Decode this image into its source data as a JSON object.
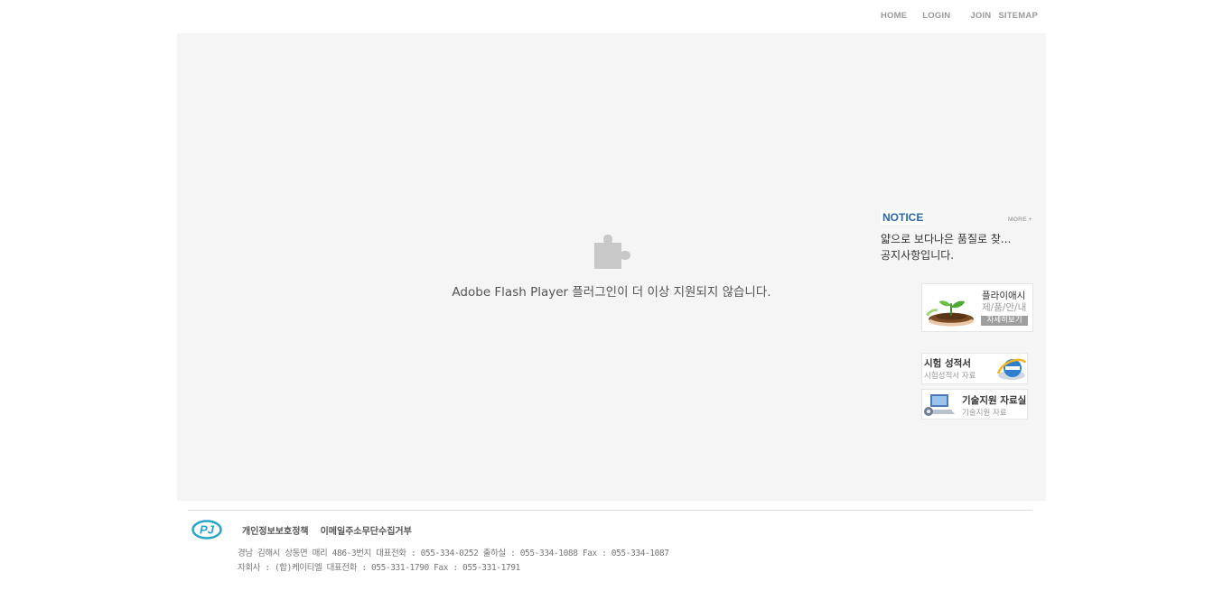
{
  "topnav": {
    "home": "HOME",
    "login": "LOGIN",
    "join": "JOIN",
    "sitemap": "SITEMAP"
  },
  "flash": {
    "message": "Adobe Flash Player 플러그인이 더 이상 지원되지 않습니다.",
    "icon": "puzzle-plugin-icon"
  },
  "notice": {
    "title": "NOTICE",
    "more": "MORE +",
    "items": [
      "얇으로 보다나은 품질로 찾...",
      "공지사항입니다."
    ]
  },
  "banners": {
    "product": {
      "title": "플라이애시",
      "subtitle": "제/품/안/내",
      "button": "자세히보기",
      "icon": "plant-in-hands-icon"
    },
    "test_report": {
      "title": "시험 성적서",
      "subtitle": "시험성적서 자료",
      "icon": "internet-explorer-icon"
    },
    "tech_support": {
      "title": "기술지원 자료실",
      "subtitle": "기술지원 자료",
      "icon": "computer-gear-icon"
    }
  },
  "footer": {
    "logo_text": "PJ",
    "links": [
      "개인정보보호정책",
      "이메일주소무단수집거부"
    ],
    "line1": "경남 김해시 상동면 매리 486-3번지   대표전화 : 055-334-0252   출하실 : 055-334-1088   Fax : 055-334-1087",
    "line2": "자회사 : (합)케이티엘 대표전화 : 055-331-1790 Fax : 055-331-1791"
  },
  "colors": {
    "accent": "#2a66a8",
    "flash_bg": "#f5f5f5",
    "logo": "#2aa3c9"
  }
}
